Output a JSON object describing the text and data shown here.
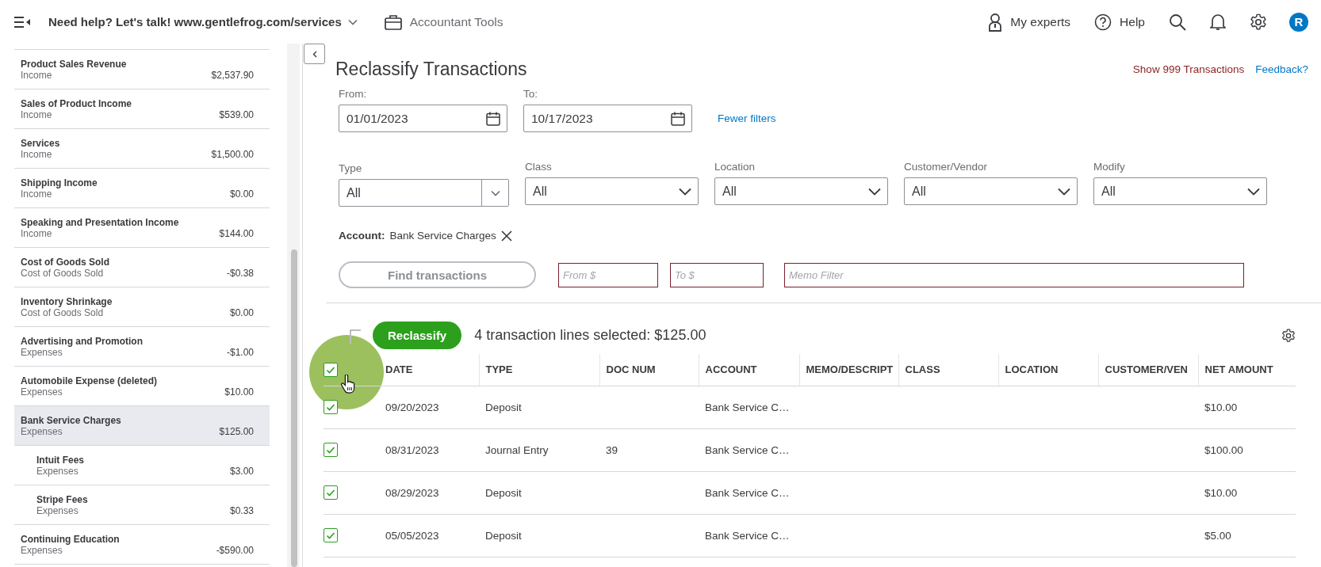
{
  "top_bar": {
    "company": "Need help? Let's talk! www.gentlefrog.com/services",
    "accountant_tools": "Accountant Tools",
    "my_experts": "My experts",
    "help": "Help",
    "avatar": "R"
  },
  "sidebar": {
    "items": [
      {
        "name": "Product Sales Revenue",
        "type": "Income",
        "amount": "$2,537.90",
        "selected": false
      },
      {
        "name": "Sales of Product Income",
        "type": "Income",
        "amount": "$539.00",
        "selected": false
      },
      {
        "name": "Services",
        "type": "Income",
        "amount": "$1,500.00",
        "selected": false
      },
      {
        "name": "Shipping Income",
        "type": "Income",
        "amount": "$0.00",
        "selected": false
      },
      {
        "name": "Speaking and Presentation Income",
        "type": "Income",
        "amount": "$144.00",
        "selected": false
      },
      {
        "name": "Cost of Goods Sold",
        "type": "Cost of Goods Sold",
        "amount": "-$0.38",
        "selected": false
      },
      {
        "name": "Inventory Shrinkage",
        "type": "Cost of Goods Sold",
        "amount": "$0.00",
        "selected": false
      },
      {
        "name": "Advertising and Promotion",
        "type": "Expenses",
        "amount": "-$1.00",
        "selected": false
      },
      {
        "name": "Automobile Expense (deleted)",
        "type": "Expenses",
        "amount": "$10.00",
        "selected": false
      },
      {
        "name": "Bank Service Charges",
        "type": "Expenses",
        "amount": "$125.00",
        "selected": true,
        "children": [
          {
            "name": "Intuit Fees",
            "type": "Expenses",
            "amount": "$3.00",
            "selected": false
          },
          {
            "name": "Stripe Fees",
            "type": "Expenses",
            "amount": "$0.33",
            "selected": false
          }
        ]
      },
      {
        "name": "Continuing Education",
        "type": "Expenses",
        "amount": "-$590.00",
        "selected": false
      }
    ]
  },
  "page": {
    "title": "Reclassify Transactions",
    "show_transactions": "Show 999 Transactions",
    "feedback": "Feedback?"
  },
  "filters": {
    "from": {
      "label": "From:",
      "value": "01/01/2023"
    },
    "to": {
      "label": "To:",
      "value": "10/17/2023"
    },
    "fewer_filters": "Fewer filters",
    "dropdowns": [
      {
        "label": "Type",
        "value": "All",
        "kind": "split"
      },
      {
        "label": "Class",
        "value": "All",
        "kind": "plain"
      },
      {
        "label": "Location",
        "value": "All",
        "kind": "plain"
      },
      {
        "label": "Customer/Vendor",
        "value": "All",
        "kind": "plain"
      },
      {
        "label": "Modify",
        "value": "All",
        "kind": "plain"
      }
    ],
    "account": {
      "label": "Account:",
      "value": "Bank Service Charges"
    },
    "find_button": {
      "label": "Find transactions",
      "disabled": true
    },
    "from_amount": {
      "placeholder": "From $"
    },
    "to_amount": {
      "placeholder": "To $"
    },
    "memo": {
      "placeholder": "Memo Filter"
    }
  },
  "table": {
    "reclassify_button": "Reclassify",
    "selection_summary": "4 transaction lines selected: $125.00",
    "select_all_checked": true,
    "columns": [
      "DATE",
      "TYPE",
      "DOC NUM",
      "ACCOUNT",
      "MEMO/DESCRIPT",
      "CLASS",
      "LOCATION",
      "CUSTOMER/VEN",
      "NET AMOUNT"
    ],
    "rows": [
      {
        "checked": true,
        "cells": [
          "09/20/2023",
          "Deposit",
          "",
          "Bank Service C…",
          "",
          "",
          "",
          "",
          "$10.00"
        ]
      },
      {
        "checked": true,
        "cells": [
          "08/31/2023",
          "Journal Entry",
          "39",
          "Bank Service C…",
          "",
          "",
          "",
          "",
          "$100.00"
        ]
      },
      {
        "checked": true,
        "cells": [
          "08/29/2023",
          "Deposit",
          "",
          "Bank Service C…",
          "",
          "",
          "",
          "",
          "$10.00"
        ]
      },
      {
        "checked": true,
        "cells": [
          "05/05/2023",
          "Deposit",
          "",
          "Bank Service C…",
          "",
          "",
          "",
          "",
          "$5.00"
        ]
      }
    ]
  }
}
